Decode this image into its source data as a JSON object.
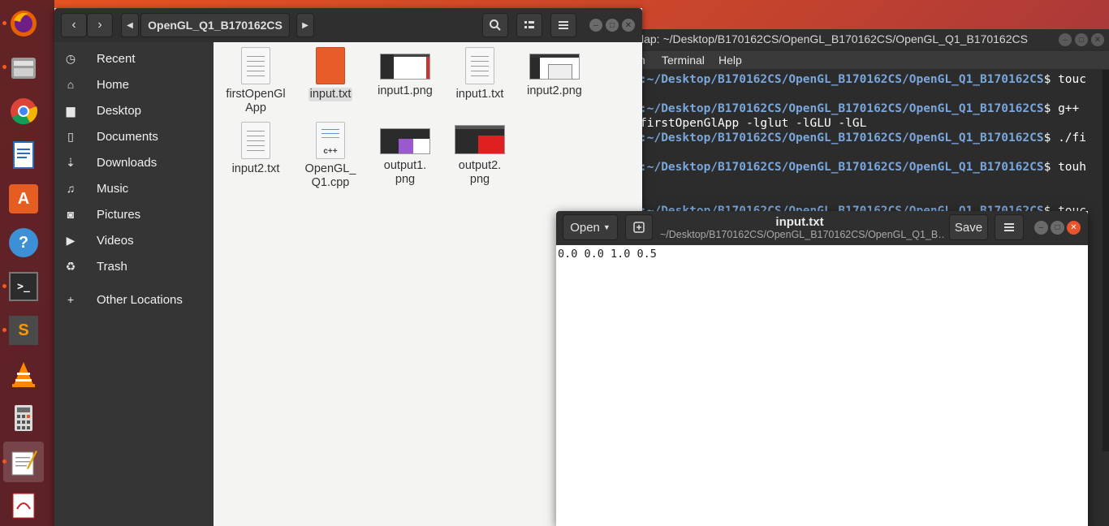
{
  "dock": {
    "items": [
      {
        "name": "firefox-icon",
        "running": true
      },
      {
        "name": "files-icon",
        "running": true
      },
      {
        "name": "chrome-icon",
        "running": false
      },
      {
        "name": "libreoffice-writer-icon",
        "running": false
      },
      {
        "name": "software-center-icon",
        "running": false,
        "glyph": "A"
      },
      {
        "name": "help-icon",
        "running": false,
        "glyph": "?"
      },
      {
        "name": "terminal-icon",
        "running": true,
        "glyph": ">_"
      },
      {
        "name": "sublime-text-icon",
        "running": true,
        "glyph": "S"
      },
      {
        "name": "vlc-icon",
        "running": false
      },
      {
        "name": "calculator-icon",
        "running": false
      },
      {
        "name": "text-editor-icon",
        "running": true
      },
      {
        "name": "document-viewer-icon",
        "running": false
      }
    ]
  },
  "files": {
    "path_label": "OpenGL_Q1_B170162CS",
    "sidebar": [
      {
        "label": "Recent",
        "icon": "clock-icon"
      },
      {
        "label": "Home",
        "icon": "home-icon"
      },
      {
        "label": "Desktop",
        "icon": "folder-icon"
      },
      {
        "label": "Documents",
        "icon": "document-icon"
      },
      {
        "label": "Downloads",
        "icon": "download-icon"
      },
      {
        "label": "Music",
        "icon": "music-icon"
      },
      {
        "label": "Pictures",
        "icon": "camera-icon"
      },
      {
        "label": "Videos",
        "icon": "video-icon"
      },
      {
        "label": "Trash",
        "icon": "trash-icon"
      },
      {
        "label": "Other Locations",
        "icon": "plus-icon"
      }
    ],
    "files": [
      {
        "name_line1": "firstOpenGl",
        "name_line2": "App",
        "kind": "doc"
      },
      {
        "name_line1": "input.txt",
        "name_line2": "",
        "kind": "doc-orange",
        "selected": true
      },
      {
        "name_line1": "input1.png",
        "name_line2": "",
        "kind": "img1"
      },
      {
        "name_line1": "input1.txt",
        "name_line2": "",
        "kind": "doc"
      },
      {
        "name_line1": "input2.png",
        "name_line2": "",
        "kind": "img2"
      },
      {
        "name_line1": "input2.txt",
        "name_line2": "",
        "kind": "doc"
      },
      {
        "name_line1": "OpenGL_",
        "name_line2": "Q1.cpp",
        "kind": "cpp",
        "cpp_label": "c++"
      },
      {
        "name_line1": "output1.",
        "name_line2": "png",
        "kind": "img3"
      },
      {
        "name_line1": "output2.",
        "name_line2": "png",
        "kind": "img4"
      }
    ]
  },
  "terminal": {
    "title": "lap: ~/Desktop/B170162CS/OpenGL_B170162CS/OpenGL_Q1_B170162CS",
    "menu": [
      "ch",
      "Terminal",
      "Help"
    ],
    "lines": [
      {
        "path": ":~/Desktop/B170162CS/OpenGL_B170162CS/OpenGL_Q1_B170162CS",
        "cmd": "$ touc"
      },
      {
        "path": ":~/Desktop/B170162CS/OpenGL_B170162CS/OpenGL_Q1_B170162CS",
        "cmd": "$ g++"
      },
      {
        "path": "",
        "cmd": "firstOpenGlApp -lglut -lGLU -lGL"
      },
      {
        "path": ":~/Desktop/B170162CS/OpenGL_B170162CS/OpenGL_Q1_B170162CS",
        "cmd": "$ ./fi"
      },
      {
        "path": ":~/Desktop/B170162CS/OpenGL_B170162CS/OpenGL_Q1_B170162CS",
        "cmd": "$ touh"
      },
      {
        "path": ":~/Desktop/B170162CS/OpenGL_B170162CS/OpenGL_Q1_B170162CS",
        "cmd": "$ touc"
      }
    ]
  },
  "gedit": {
    "open_label": "Open",
    "save_label": "Save",
    "title": "input.txt",
    "subtitle": "~/Desktop/B170162CS/OpenGL_B170162CS/OpenGL_Q1_B…",
    "content": "0.0 0.0 1.0 0.5"
  }
}
